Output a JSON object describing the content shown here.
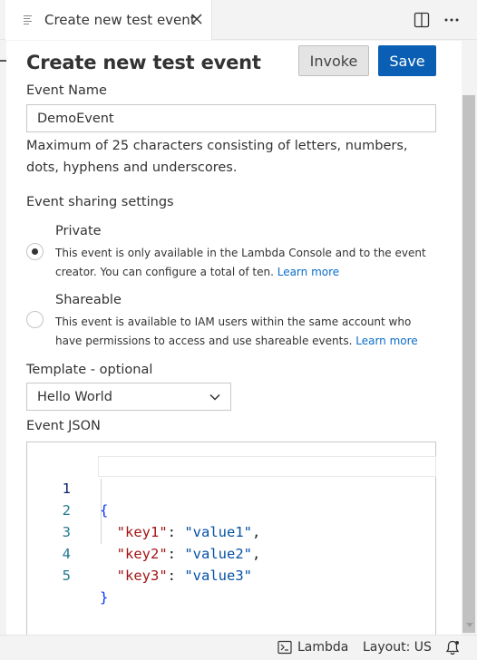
{
  "tab": {
    "title": "Create new test event"
  },
  "header": {
    "title": "Create new test event",
    "invoke_label": "Invoke",
    "save_label": "Save"
  },
  "event_name": {
    "label": "Event Name",
    "value": "DemoEvent",
    "hint": "Maximum of 25 characters consisting of letters, numbers, dots, hyphens and underscores."
  },
  "sharing": {
    "label": "Event sharing settings",
    "options": [
      {
        "title": "Private",
        "description": "This event is only available in the Lambda Console and to the event creator. You can configure a total of ten.",
        "link": "Learn more",
        "selected": true
      },
      {
        "title": "Shareable",
        "description": "This event is available to IAM users within the same account who have permissions to access and use shareable events.",
        "link": "Learn more",
        "selected": false
      }
    ]
  },
  "template": {
    "label": "Template - optional",
    "selected": "Hello World"
  },
  "event_json": {
    "label": "Event JSON",
    "line_numbers": [
      "1",
      "2",
      "3",
      "4",
      "5"
    ],
    "open_brace": "{",
    "close_brace": "}",
    "pairs": [
      {
        "key": "\"key1\"",
        "value": "\"value1\"",
        "sep": ": ",
        "trail": ","
      },
      {
        "key": "\"key2\"",
        "value": "\"value2\"",
        "sep": ": ",
        "trail": ","
      },
      {
        "key": "\"key3\"",
        "value": "\"value3\"",
        "sep": ": ",
        "trail": ""
      }
    ]
  },
  "statusbar": {
    "lambda_label": "Lambda",
    "layout_label": "Layout: US"
  },
  "colors": {
    "accent": "#0a5fb4",
    "link": "#0b6cc9",
    "json_key": "#a31515",
    "json_string": "#0451a5",
    "json_brace": "#0431fa"
  }
}
